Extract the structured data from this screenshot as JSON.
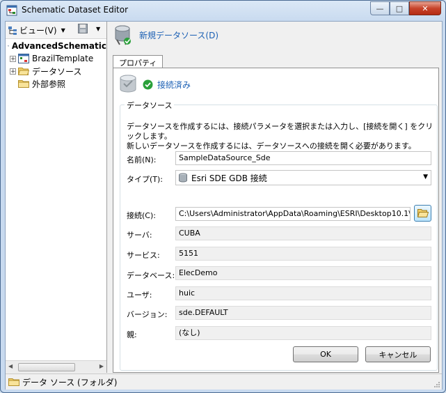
{
  "window": {
    "title": "Schematic Dataset Editor"
  },
  "left_toolbar": {
    "view_label": "ビュー(V)"
  },
  "tree": {
    "root": "AdvancedSchematic",
    "items": [
      {
        "label": "BrazilTemplate",
        "expandable": true
      },
      {
        "label": "データソース",
        "expandable": true
      },
      {
        "label": "外部参照",
        "expandable": false
      }
    ]
  },
  "header": {
    "new_datasource_label": "新規データソース(D)"
  },
  "tabs": [
    {
      "label": "プロパティ"
    }
  ],
  "status": {
    "label": "接続済み"
  },
  "datasource": {
    "group_title": "データソース",
    "description_line1": "データソースを作成するには、接続パラメータを選択または入力し、[接続を開く] をクリックします。",
    "description_line2": "新しいデータソースを作成するには、データソースへの接続を開く必要があります。",
    "name_label": "名前(N):",
    "name_value": "SampleDataSource_Sde",
    "type_label": "タイプ(T):",
    "type_value": "Esri SDE GDB 接続",
    "connection_label": "接続(C):",
    "connection_value": "C:\\Users\\Administrator\\AppData\\Roaming\\ESRI\\Desktop10.1\\",
    "server_label": "サーバ:",
    "server_value": "CUBA",
    "service_label": "サービス:",
    "service_value": "5151",
    "database_label": "データベース:",
    "database_value": "ElecDemo",
    "user_label": "ユーザ:",
    "user_value": "huic",
    "version_label": "バージョン:",
    "version_value": "sde.DEFAULT",
    "parent_label": "親:",
    "parent_value": "(なし)"
  },
  "buttons": {
    "ok": "OK",
    "cancel": "キャンセル"
  },
  "statusbar": {
    "label": "データ ソース (フォルダ)"
  },
  "colors": {
    "link_blue": "#1a5fb4",
    "status_green": "#2aa03a",
    "title_bar": "#c8daef"
  }
}
